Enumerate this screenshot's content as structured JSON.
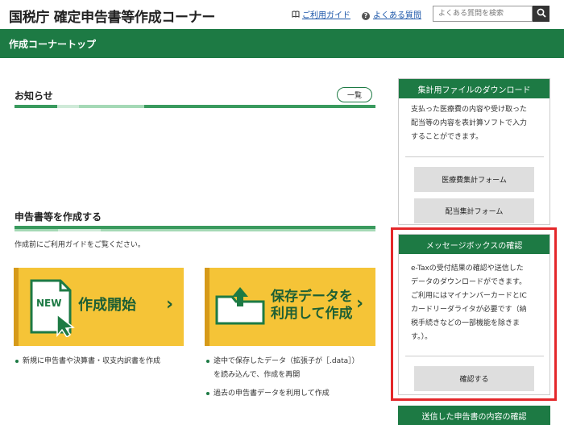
{
  "header": {
    "title": "国税庁 確定申告書等作成コーナー",
    "guide_link": "ご利用ガイド",
    "faq_link": "よくある質問",
    "search_placeholder": "よくある質問を検索"
  },
  "nav": {
    "title": "作成コーナートップ"
  },
  "news": {
    "heading": "お知らせ",
    "list_button": "一覧"
  },
  "create": {
    "heading": "申告書等を作成する",
    "note": "作成前にご利用ガイドをご覧ください。",
    "tile_new": {
      "badge": "NEW",
      "label": "作成開始"
    },
    "tile_saved": {
      "label_line1": "保存データを",
      "label_line2": "利用して作成"
    },
    "new_bullets": [
      "新規に申告書や決算書・収支内訳書を作成"
    ],
    "saved_bullets": [
      "途中で保存したデータ（拡張子が［.data］）",
      "を読み込んで、作成を再開",
      "過去の申告書データを利用して作成"
    ]
  },
  "sidebar": {
    "download": {
      "title": "集計用ファイルのダウンロード",
      "text_lines": [
        "支払った医療費の内容や受け取った",
        "配当等の内容を表計算ソフトで入力",
        "することができます。"
      ],
      "button1": "医療費集計フォーム",
      "button2": "配当集計フォーム"
    },
    "messagebox": {
      "title": "メッセージボックスの確認",
      "text_lines": [
        "e-Taxの受付結果の確認や送信した",
        "データのダウンロードができます。",
        "ご利用にはマイナンバーカードとIC",
        "カードリーダライタが必要です（納",
        "税手続きなどの一部機能を除きま",
        "す。）。"
      ],
      "button": "確認する"
    },
    "sent": {
      "title": "送信した申告書の内容の確認"
    }
  },
  "colors": {
    "brand_green": "#1d7a44",
    "tile_yellow": "#f5c437",
    "highlight_red": "#e4272a"
  }
}
